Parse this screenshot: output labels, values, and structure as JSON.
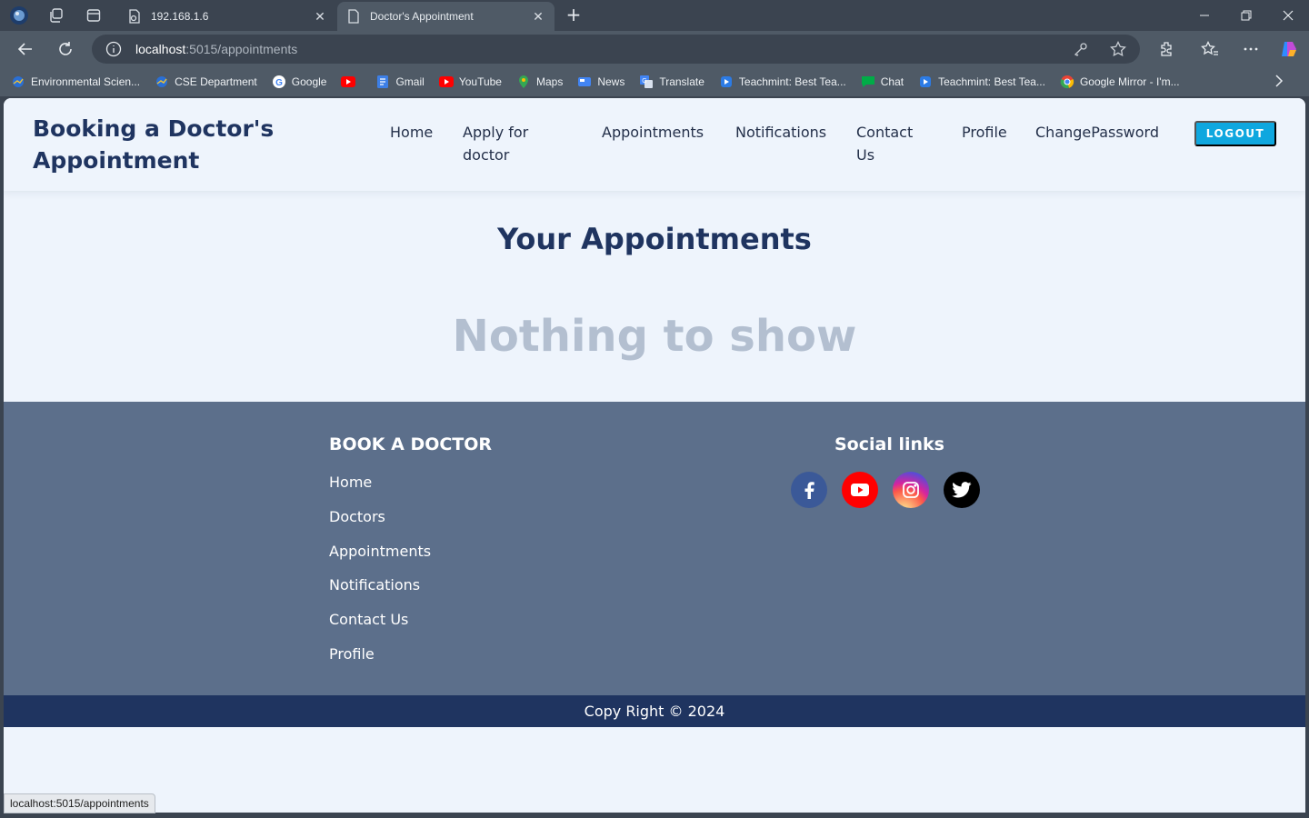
{
  "browser": {
    "tabs": [
      {
        "title": "192.168.1.6",
        "active": false
      },
      {
        "title": "Doctor's Appointment",
        "active": true
      }
    ],
    "address": {
      "host": "localhost",
      "path": ":5015/appointments"
    },
    "bookmarks": [
      {
        "label": "Environmental Scien...",
        "icon": "bookmark-site-icon"
      },
      {
        "label": "CSE Department",
        "icon": "bookmark-site-icon"
      },
      {
        "label": "Google",
        "icon": "google-icon"
      },
      {
        "label": "",
        "icon": "youtube-icon"
      },
      {
        "label": "Gmail",
        "icon": "gmail-icon"
      },
      {
        "label": "YouTube",
        "icon": "youtube-icon"
      },
      {
        "label": "Maps",
        "icon": "maps-icon"
      },
      {
        "label": "News",
        "icon": "news-icon"
      },
      {
        "label": "Translate",
        "icon": "translate-icon"
      },
      {
        "label": "Teachmint: Best Tea...",
        "icon": "teachmint-icon"
      },
      {
        "label": "Chat",
        "icon": "chat-icon"
      },
      {
        "label": "Teachmint: Best Tea...",
        "icon": "teachmint-icon"
      },
      {
        "label": "Google Mirror - I'm...",
        "icon": "chrome-icon"
      }
    ],
    "status_url": "localhost:5015/appointments"
  },
  "header": {
    "brand_line1": "Booking a Doctor's",
    "brand_line2": "Appointment",
    "nav": [
      {
        "label": "Home"
      },
      {
        "label": "Apply for",
        "label2": "doctor"
      },
      {
        "label": "Appointments"
      },
      {
        "label": "Notifications"
      },
      {
        "label": "Contact",
        "label2": "Us"
      },
      {
        "label": "Profile"
      },
      {
        "label": "ChangePassword"
      }
    ],
    "logout_label": "LOGOUT"
  },
  "main": {
    "title": "Your Appointments",
    "empty_message": "Nothing to show"
  },
  "footer": {
    "heading": "BOOK A DOCTOR",
    "links": [
      "Home",
      "Doctors",
      "Appointments",
      "Notifications",
      "Contact Us",
      "Profile"
    ],
    "social_heading": "Social links",
    "social": [
      {
        "name": "facebook",
        "color": "#3b5998"
      },
      {
        "name": "youtube",
        "color": "#ff0000"
      },
      {
        "name": "instagram",
        "color": "#d6249f"
      },
      {
        "name": "twitter",
        "color": "#000000"
      }
    ],
    "copyright": "Copy Right © 2024"
  },
  "colors": {
    "brand": "#1f3460",
    "accent": "#0fa7df",
    "footer": "#5c6f8b",
    "page_bg": "#eef4fc"
  }
}
